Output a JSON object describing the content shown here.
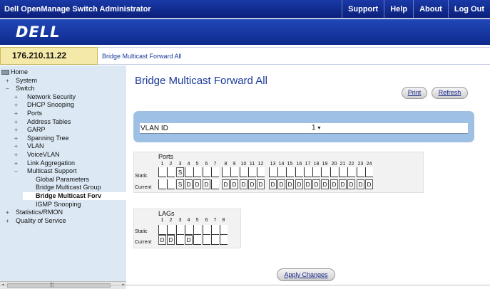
{
  "topbar": {
    "app_title": "Dell OpenManage Switch Administrator",
    "links": [
      "Support",
      "Help",
      "About",
      "Log Out"
    ]
  },
  "logo": "DELL",
  "address": {
    "ip": "176.210.11.22",
    "breadcrumb": "Bridge Multicast Forward All"
  },
  "tree": [
    {
      "label": "Home",
      "indent": 0,
      "toggle": "",
      "folder": true
    },
    {
      "label": "System",
      "indent": 1,
      "toggle": "+"
    },
    {
      "label": "Switch",
      "indent": 1,
      "toggle": "−"
    },
    {
      "label": "Network Security",
      "indent": 2,
      "toggle": "+"
    },
    {
      "label": "DHCP Snooping",
      "indent": 2,
      "toggle": "+"
    },
    {
      "label": "Ports",
      "indent": 2,
      "toggle": "+"
    },
    {
      "label": "Address Tables",
      "indent": 2,
      "toggle": "+"
    },
    {
      "label": "GARP",
      "indent": 2,
      "toggle": "+"
    },
    {
      "label": "Spanning Tree",
      "indent": 2,
      "toggle": "+"
    },
    {
      "label": "VLAN",
      "indent": 2,
      "toggle": "+"
    },
    {
      "label": "VoiceVLAN",
      "indent": 2,
      "toggle": "+"
    },
    {
      "label": "Link Aggregation",
      "indent": 2,
      "toggle": "+"
    },
    {
      "label": "Multicast Support",
      "indent": 2,
      "toggle": "−"
    },
    {
      "label": "Global Parameters",
      "indent": 3,
      "toggle": ""
    },
    {
      "label": "Bridge Multicast Group",
      "indent": 3,
      "toggle": ""
    },
    {
      "label": "Bridge Multicast Forv",
      "indent": 3,
      "toggle": "",
      "selected": true
    },
    {
      "label": "IGMP Snooping",
      "indent": 3,
      "toggle": ""
    },
    {
      "label": "Statistics/RMON",
      "indent": 1,
      "toggle": "+"
    },
    {
      "label": "Quality of Service",
      "indent": 1,
      "toggle": "+"
    }
  ],
  "main": {
    "title": "Bridge Multicast Forward All",
    "print_label": "Print",
    "refresh_label": "Refresh",
    "vlan_label": "VLAN ID",
    "vlan_value": "1",
    "apply_label": "Apply Changes"
  },
  "ports": {
    "title": "Ports",
    "static_label": "Static",
    "current_label": "Current",
    "numbers": [
      "1",
      "2",
      "3",
      "4",
      "5",
      "6",
      "7",
      "8",
      "9",
      "10",
      "11",
      "12",
      "13",
      "14",
      "15",
      "16",
      "17",
      "18",
      "19",
      "20",
      "21",
      "22",
      "23",
      "24"
    ],
    "static": [
      "",
      "",
      "S",
      "",
      "",
      "",
      "",
      "",
      "",
      "",
      "",
      "",
      "",
      "",
      "",
      "",
      "",
      "",
      "",
      "",
      "",
      "",
      "",
      ""
    ],
    "current": [
      "",
      "",
      "S",
      "D",
      "D",
      "D",
      "",
      "D",
      "D",
      "D",
      "D",
      "D",
      "D",
      "D",
      "D",
      "D",
      "D",
      "D",
      "D",
      "D",
      "D",
      "D",
      "D",
      "D"
    ]
  },
  "lags": {
    "title": "LAGs",
    "static_label": "Static",
    "current_label": "Current",
    "numbers": [
      "1",
      "2",
      "3",
      "4",
      "5",
      "6",
      "7",
      "8"
    ],
    "static": [
      "",
      "",
      "",
      "",
      "",
      "",
      "",
      ""
    ],
    "current": [
      "D",
      "D",
      "",
      "D",
      "",
      "",
      "",
      ""
    ]
  }
}
